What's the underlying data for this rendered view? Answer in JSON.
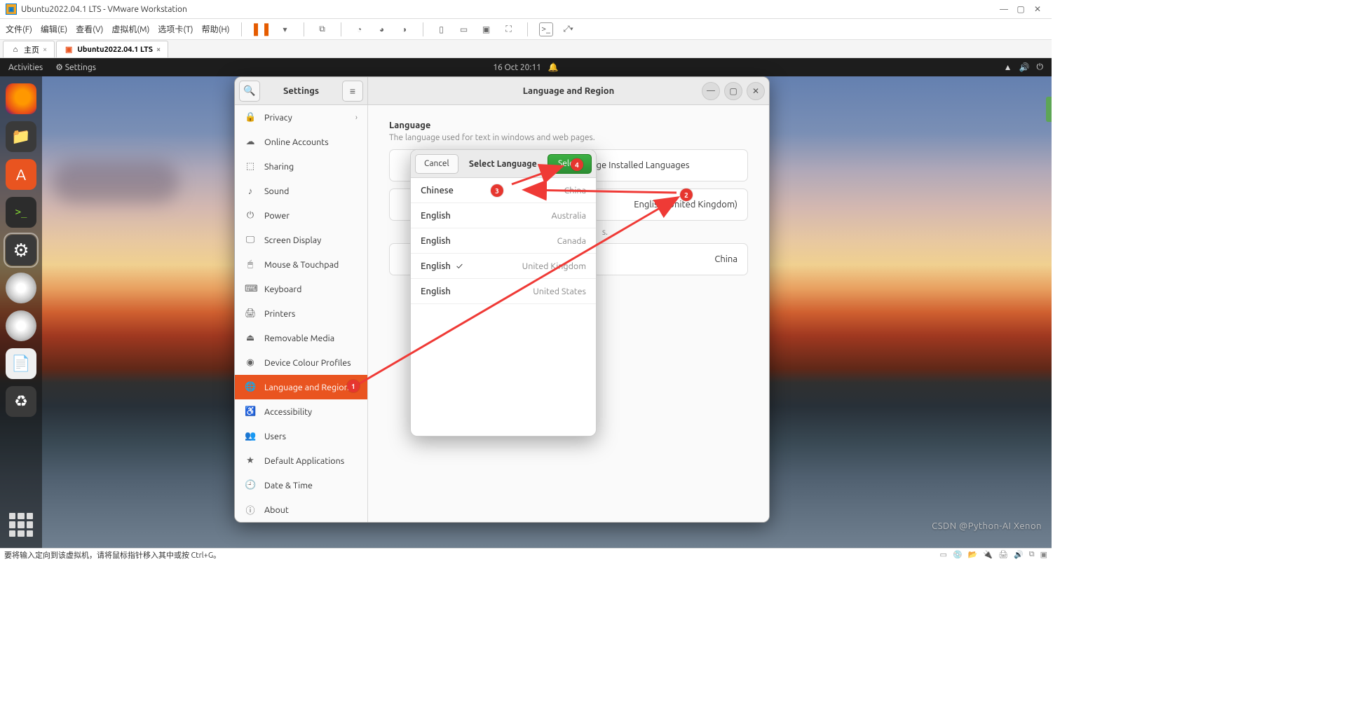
{
  "win_title": "Ubuntu2022.04.1 LTS - VMware Workstation",
  "vm_menu": [
    "文件(F)",
    "编辑(E)",
    "查看(V)",
    "虚拟机(M)",
    "选项卡(T)",
    "帮助(H)"
  ],
  "vm_tabs": {
    "home": "主页",
    "active": "Ubuntu2022.04.1 LTS"
  },
  "topbar": {
    "activities": "Activities",
    "settings": "Settings",
    "datetime": "16 Oct  20:11"
  },
  "settings_win": {
    "search_title": "Settings",
    "right_title": "Language and Region",
    "sidebar": [
      {
        "icon": "🔒",
        "label": "Privacy",
        "chev": true
      },
      {
        "icon": "☁",
        "label": "Online Accounts"
      },
      {
        "icon": "⬚",
        "label": "Sharing"
      },
      {
        "icon": "♪",
        "label": "Sound"
      },
      {
        "icon": "⏻",
        "label": "Power"
      },
      {
        "icon": "🖵",
        "label": "Screen Display"
      },
      {
        "icon": "🖱",
        "label": "Mouse & Touchpad"
      },
      {
        "icon": "⌨",
        "label": "Keyboard"
      },
      {
        "icon": "🖨",
        "label": "Printers"
      },
      {
        "icon": "⏏",
        "label": "Removable Media"
      },
      {
        "icon": "◉",
        "label": "Device Colour Profiles"
      },
      {
        "icon": "🌐",
        "label": "Language and Region",
        "active": true
      },
      {
        "icon": "♿",
        "label": "Accessibility"
      },
      {
        "icon": "👥",
        "label": "Users"
      },
      {
        "icon": "★",
        "label": "Default Applications"
      },
      {
        "icon": "🕘",
        "label": "Date & Time"
      },
      {
        "icon": "ⓘ",
        "label": "About"
      }
    ],
    "content": {
      "language_heading": "Language",
      "language_desc": "The language used for text in windows and web pages.",
      "manage_langs": "Manage Installed Languages",
      "language_value": "English (United Kingdom)",
      "formats_value": "China",
      "hidden_row_suffix": "s."
    }
  },
  "lang_modal": {
    "cancel": "Cancel",
    "title": "Select Language",
    "select": "Select",
    "items": [
      {
        "lang": "Chinese",
        "region": "China"
      },
      {
        "lang": "English",
        "region": "Australia"
      },
      {
        "lang": "English",
        "region": "Canada"
      },
      {
        "lang": "English",
        "region": "United Kingdom",
        "checked": true
      },
      {
        "lang": "English",
        "region": "United States"
      }
    ]
  },
  "badges": {
    "1": "1",
    "2": "2",
    "3": "3",
    "4": "4"
  },
  "statusbar": "要将输入定向到该虚拟机，请将鼠标指针移入其中或按 Ctrl+G。",
  "watermark": "CSDN @Python-AI Xenon"
}
